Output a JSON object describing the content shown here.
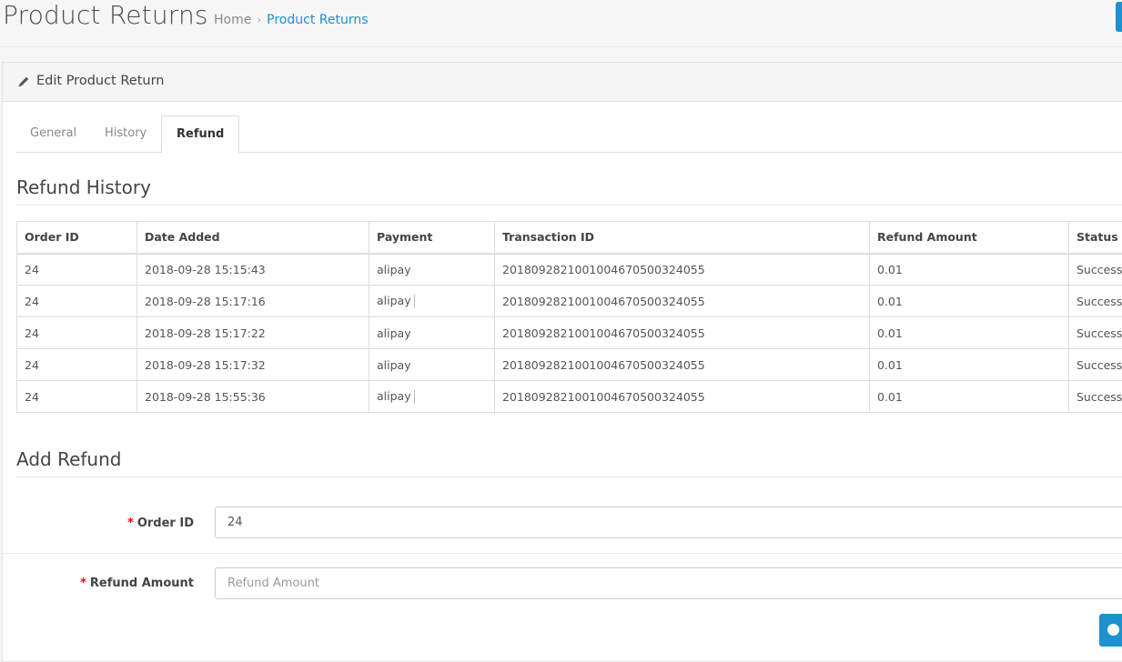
{
  "header": {
    "title": "Product Returns",
    "breadcrumb": {
      "home": "Home",
      "separator": "›",
      "current": "Product Returns"
    }
  },
  "panel": {
    "title": "Edit Product Return",
    "icon": "pencil-icon"
  },
  "tabs": [
    {
      "label": "General",
      "active": false
    },
    {
      "label": "History",
      "active": false
    },
    {
      "label": "Refund",
      "active": true
    }
  ],
  "refund_history": {
    "heading": "Refund History",
    "columns": [
      "Order ID",
      "Date Added",
      "Payment",
      "Transaction ID",
      "Refund Amount",
      "Status"
    ],
    "rows": [
      [
        "24",
        "2018-09-28 15:15:43",
        "alipay",
        "2018092821001004670500324055",
        "0.01",
        "Success"
      ],
      [
        "24",
        "2018-09-28 15:17:16",
        "alipay",
        "2018092821001004670500324055",
        "0.01",
        "Success"
      ],
      [
        "24",
        "2018-09-28 15:17:22",
        "alipay",
        "2018092821001004670500324055",
        "0.01",
        "Success"
      ],
      [
        "24",
        "2018-09-28 15:17:32",
        "alipay",
        "2018092821001004670500324055",
        "0.01",
        "Success"
      ],
      [
        "24",
        "2018-09-28 15:55:36",
        "alipay",
        "2018092821001004670500324055",
        "0.01",
        "Success"
      ]
    ]
  },
  "add_refund": {
    "heading": "Add Refund",
    "required_mark": "*",
    "order_id": {
      "label": "Order ID",
      "value": "24"
    },
    "refund_amount": {
      "label": "Refund Amount",
      "value": "",
      "placeholder": "Refund Amount"
    }
  },
  "colors": {
    "accent": "#1e91cf",
    "required": "#ff0000"
  }
}
